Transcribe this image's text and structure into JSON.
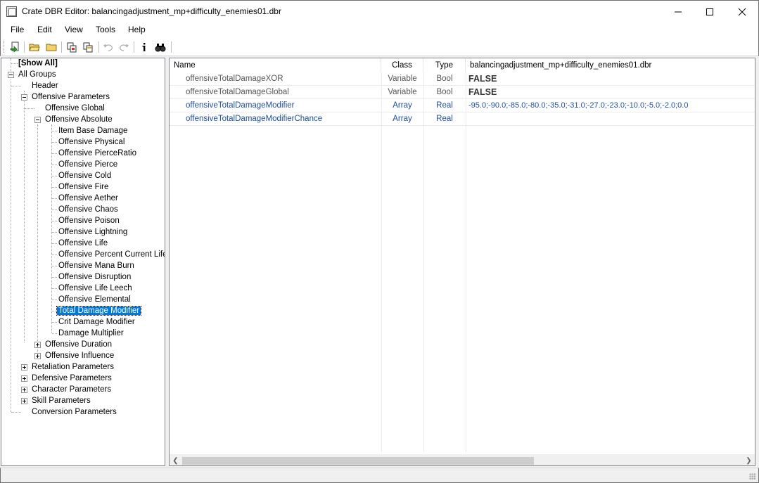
{
  "window": {
    "title": "Crate DBR Editor: balancingadjustment_mp+difficulty_enemies01.dbr"
  },
  "menu": [
    "File",
    "Edit",
    "View",
    "Tools",
    "Help"
  ],
  "toolbar": {
    "icons": [
      "open-record-icon",
      "open-folder-icon",
      "folder-icon",
      "copy-records-icon",
      "paste-records-icon",
      "undo-icon",
      "redo-icon",
      "info-icon",
      "find-icon"
    ]
  },
  "tree": {
    "show_all": "[Show All]",
    "all_groups": "All Groups",
    "header": "Header",
    "offensive_parameters": "Offensive Parameters",
    "offensive_global": "Offensive Global",
    "offensive_absolute": "Offensive Absolute",
    "absolute_children": [
      "Item Base Damage",
      "Offensive Physical",
      "Offensive PierceRatio",
      "Offensive Pierce",
      "Offensive Cold",
      "Offensive Fire",
      "Offensive Aether",
      "Offensive Chaos",
      "Offensive Poison",
      "Offensive Lightning",
      "Offensive Life",
      "Offensive Percent Current Life",
      "Offensive Mana Burn",
      "Offensive Disruption",
      "Offensive Life Leech",
      "Offensive Elemental",
      "Total Damage Modifier",
      "Crit Damage Modifier",
      "Damage Multiplier"
    ],
    "offensive_duration": "Offensive Duration",
    "offensive_influence": "Offensive Influence",
    "top_groups": [
      "Retaliation Parameters",
      "Defensive Parameters",
      "Character Parameters",
      "Skill Parameters",
      "Conversion Parameters"
    ],
    "selected": "Total Damage Modifier"
  },
  "grid": {
    "columns": {
      "name": "Name",
      "class": "Class",
      "type": "Type",
      "value": "balancingadjustment_mp+difficulty_enemies01.dbr"
    },
    "rows": [
      {
        "name": "offensiveTotalDamageXOR",
        "class": "Variable",
        "type": "Bool",
        "value": "FALSE"
      },
      {
        "name": "offensiveTotalDamageGlobal",
        "class": "Variable",
        "type": "Bool",
        "value": "FALSE"
      },
      {
        "name": "offensiveTotalDamageModifier",
        "class": "Array",
        "type": "Real",
        "value": "-95.0;-90.0;-85.0;-80.0;-35.0;-31.0;-27.0;-23.0;-10.0;-5.0;-2.0;0.0"
      },
      {
        "name": "offensiveTotalDamageModifierChance",
        "class": "Array",
        "type": "Real",
        "value": ""
      }
    ]
  },
  "colors": {
    "selection": "#0078d7",
    "array_row_text": "#1f4e9a",
    "variable_row_text": "#555555"
  }
}
